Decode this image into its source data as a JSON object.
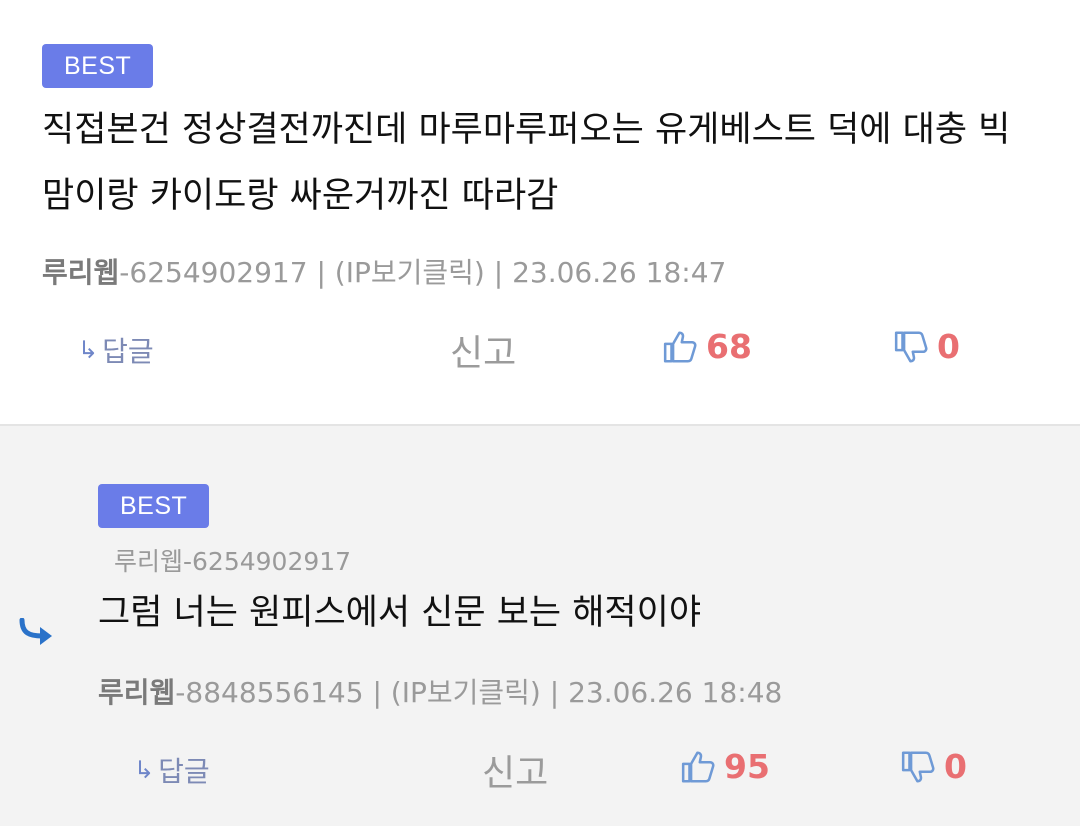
{
  "comments": [
    {
      "badge": "BEST",
      "content": "직접본건 정상결전까진데 마루마루퍼오는 유게베스트 덕에 대충 빅맘이랑 카이도랑 싸운거까진 따라감",
      "author": "루리웹",
      "author_id": "-6254902917",
      "separator": "|",
      "ip_label": "(IP보기클릭)",
      "timestamp": "23.06.26 18:47",
      "reply_label": "답글",
      "report_label": "신고",
      "upvotes": "68",
      "downvotes": "0"
    },
    {
      "badge": "BEST",
      "reply_to": "루리웹-6254902917",
      "content": "그럼 너는 원피스에서 신문 보는 해적이야",
      "author": "루리웹",
      "author_id": "-8848556145",
      "separator": "|",
      "ip_label": "(IP보기클릭)",
      "timestamp": "23.06.26 18:48",
      "reply_label": "답글",
      "report_label": "신고",
      "upvotes": "95",
      "downvotes": "0"
    }
  ],
  "icons": {
    "reply_arrow": "reply-arrow-icon",
    "thumbs_up": "thumbs-up-icon",
    "thumbs_down": "thumbs-down-icon",
    "nested_reply": "nested-reply-icon"
  },
  "colors": {
    "badge": "#6a7ce8",
    "vote_count": "#e96f72",
    "thumb_icon": "#6f9ad6",
    "reply_bg": "#f3f3f3"
  }
}
